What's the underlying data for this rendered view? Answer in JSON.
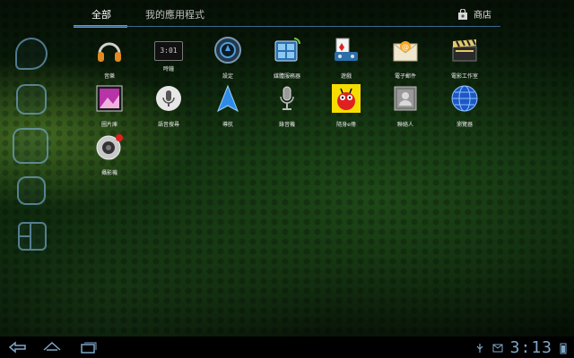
{
  "tabs": {
    "all_label": "全部",
    "mine_label": "我的應用程式"
  },
  "store": {
    "label": "商店",
    "icon": "shopping-bag-icon"
  },
  "apps": [
    {
      "label": "音樂",
      "icon": "headphones-icon"
    },
    {
      "label": "時鐘",
      "icon": "clock-icon"
    },
    {
      "label": "設定",
      "icon": "settings-icon"
    },
    {
      "label": "媒體服務器",
      "icon": "media-server-icon"
    },
    {
      "label": "遊戲",
      "icon": "games-icon"
    },
    {
      "label": "電子郵件",
      "icon": "email-icon"
    },
    {
      "label": "電影工作室",
      "icon": "clapperboard-icon"
    },
    {
      "label": "圖片庫",
      "icon": "gallery-icon"
    },
    {
      "label": "語音搜尋",
      "icon": "microphone-search-icon"
    },
    {
      "label": "導航",
      "icon": "navigation-arrow-icon"
    },
    {
      "label": "錄音機",
      "icon": "recorder-microphone-icon"
    },
    {
      "label": "隨身e冊",
      "icon": "ebook-ant-icon"
    },
    {
      "label": "聯絡人",
      "icon": "contacts-icon"
    },
    {
      "label": "瀏覽器",
      "icon": "globe-icon"
    },
    {
      "label": "攝影機",
      "icon": "camera-icon"
    }
  ],
  "clock_icon_text": "3:01",
  "status": {
    "time": "3:13"
  },
  "colors": {
    "accent": "#4aa0df",
    "clock": "#7ea6c7"
  }
}
